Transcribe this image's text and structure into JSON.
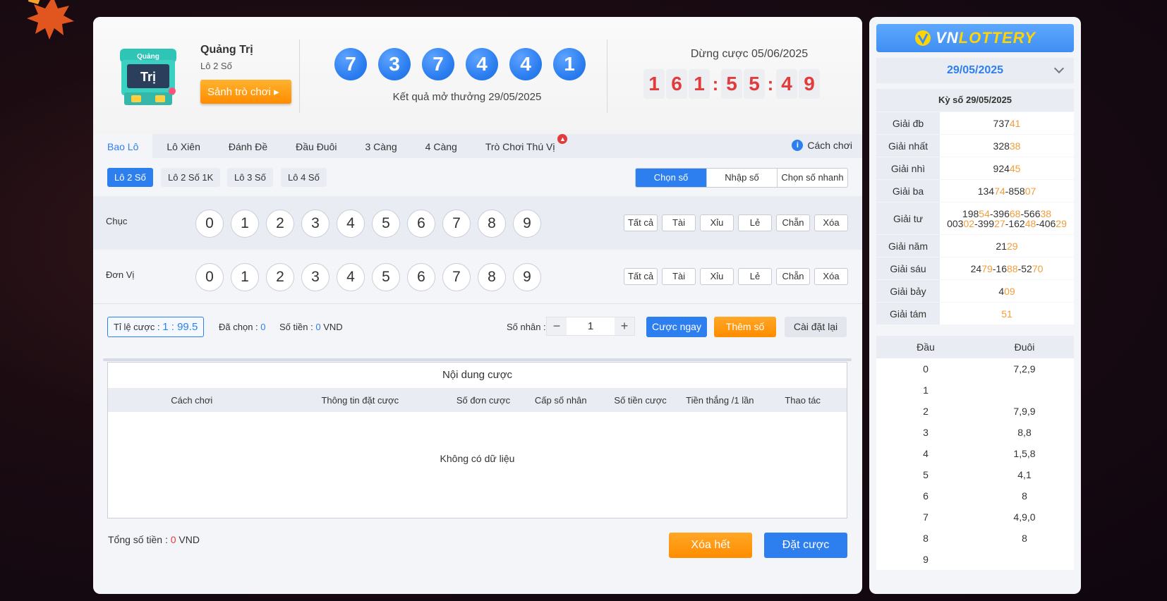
{
  "game": {
    "title": "Quảng Trị",
    "subtitle": "Lô 2 Số",
    "lobby_button": "Sảnh trò chơi ▸",
    "logo_text": "Quảng Trị"
  },
  "result": {
    "balls": [
      "7",
      "3",
      "7",
      "4",
      "4",
      "1"
    ],
    "label": "Kết quả mở thưởng 29/05/2025"
  },
  "countdown": {
    "label": "Dừng cược 05/06/2025",
    "digits": [
      "1",
      "6",
      "1",
      ":",
      "5",
      "5",
      ":",
      "4",
      "9"
    ]
  },
  "tabs": [
    "Bao Lô",
    "Lô Xiên",
    "Đánh Đề",
    "Đầu Đuôi",
    "3 Càng",
    "4 Càng",
    "Trò Chơi Thú Vị"
  ],
  "how_to_play": "Cách chơi",
  "subtabs": [
    "Lô 2 Số",
    "Lô 2 Số 1K",
    "Lô 3 Số",
    "Lô 4 Số"
  ],
  "modes": [
    "Chọn số",
    "Nhập số",
    "Chọn số nhanh"
  ],
  "rows": [
    {
      "label": "Chục"
    },
    {
      "label": "Đơn Vị"
    }
  ],
  "numbers": [
    "0",
    "1",
    "2",
    "3",
    "4",
    "5",
    "6",
    "7",
    "8",
    "9"
  ],
  "quick_picks": [
    "Tất cả",
    "Tài",
    "Xỉu",
    "Lẻ",
    "Chẵn",
    "Xóa"
  ],
  "bet": {
    "odds_label": "Tỉ lệ cược :",
    "odds_value": "1 : 99.5",
    "selected_label": "Đã chọn :",
    "selected_value": "0",
    "amount_label": "Số tiền :",
    "amount_value": "0",
    "currency": "VND",
    "multiplier_label": "Số nhân :",
    "multiplier_value": "1",
    "minus": "−",
    "plus": "+",
    "bet_now": "Cược ngay",
    "add_number": "Thêm số",
    "reset": "Cài đặt lại"
  },
  "content": {
    "title": "Nội dung cược",
    "columns": [
      "Cách chơi",
      "Thông tin đặt cược",
      "Số đơn cược",
      "Cấp số nhân",
      "Số tiền cược",
      "Tiền thắng /1 lần",
      "Thao tác"
    ],
    "empty": "Không có dữ liệu"
  },
  "footer": {
    "total_label": "Tổng số tiền :",
    "total_value": "0",
    "currency": "VND",
    "clear_all": "Xóa hết",
    "place_bet": "Đặt cược"
  },
  "sidebar": {
    "brand_v": "V",
    "brand_n": "N",
    "brand_rest": "LOTTERY",
    "date": "29/05/2025",
    "ky_so": "Kỳ số 29/05/2025",
    "prizes": [
      {
        "name": "Giải đb",
        "lines": [
          [
            [
              "737",
              ""
            ],
            [
              "41",
              "or"
            ]
          ]
        ]
      },
      {
        "name": "Giải nhất",
        "lines": [
          [
            [
              "328",
              ""
            ],
            [
              "38",
              "or"
            ]
          ]
        ]
      },
      {
        "name": "Giải nhì",
        "lines": [
          [
            [
              "924",
              ""
            ],
            [
              "45",
              "or"
            ]
          ]
        ]
      },
      {
        "name": "Giải ba",
        "lines": [
          [
            [
              "134",
              ""
            ],
            [
              "74",
              "or"
            ],
            [
              "-858",
              ""
            ],
            [
              "07",
              "or"
            ]
          ]
        ]
      },
      {
        "name": "Giải tư",
        "lines": [
          [
            [
              "198",
              ""
            ],
            [
              "54",
              "or"
            ],
            [
              "-396",
              ""
            ],
            [
              "68",
              "or"
            ],
            [
              "-566",
              ""
            ],
            [
              "38",
              "or"
            ]
          ],
          [
            [
              "003",
              ""
            ],
            [
              "02",
              "or"
            ],
            [
              "-399",
              ""
            ],
            [
              "27",
              "or"
            ],
            [
              "-162",
              ""
            ],
            [
              "48",
              "or"
            ],
            [
              "-406",
              ""
            ],
            [
              "29",
              "or"
            ]
          ]
        ]
      },
      {
        "name": "Giải năm",
        "lines": [
          [
            [
              "21",
              ""
            ],
            [
              "29",
              "or"
            ]
          ]
        ]
      },
      {
        "name": "Giải sáu",
        "lines": [
          [
            [
              "24",
              ""
            ],
            [
              "79",
              "or"
            ],
            [
              "-16",
              ""
            ],
            [
              "88",
              "or"
            ],
            [
              "-52",
              ""
            ],
            [
              "70",
              "or"
            ]
          ]
        ]
      },
      {
        "name": "Giải bảy",
        "lines": [
          [
            [
              "4",
              ""
            ],
            [
              "09",
              "or"
            ]
          ]
        ]
      },
      {
        "name": "Giải tám",
        "lines": [
          [
            [
              "51",
              "or"
            ]
          ]
        ]
      }
    ],
    "dd_head": [
      "Đầu",
      "Đuôi"
    ],
    "dd_rows": [
      [
        "0",
        "7,2,9"
      ],
      [
        "1",
        ""
      ],
      [
        "2",
        "7,9,9"
      ],
      [
        "3",
        "8,8"
      ],
      [
        "4",
        "1,5,8"
      ],
      [
        "5",
        "4,1"
      ],
      [
        "6",
        "8"
      ],
      [
        "7",
        "4,9,0"
      ],
      [
        "8",
        "8"
      ],
      [
        "9",
        ""
      ]
    ]
  },
  "colors": {
    "accent": "#2d7ff0",
    "orange": "#ff8c00",
    "red": "#e23b3b",
    "highlight": "#f39c3a"
  }
}
